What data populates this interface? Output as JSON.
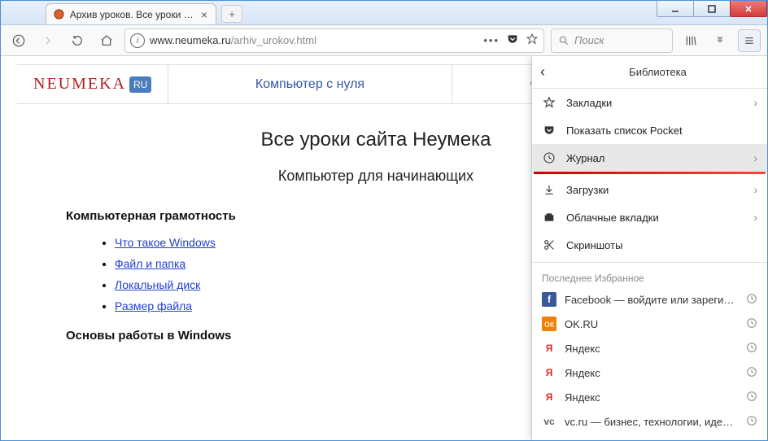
{
  "window": {
    "tab_title": "Архив уроков. Все уроки сайт",
    "url_host": "www.neumeka.ru",
    "url_path": "/arhiv_urokov.html",
    "search_placeholder": "Поиск"
  },
  "site": {
    "logo": "NEUMEKA",
    "logo_badge": "RU",
    "nav": [
      "Компьютер с нуля",
      "Обучение Интернету"
    ]
  },
  "page": {
    "h1": "Все уроки сайта Неумека",
    "h2": "Компьютер для начинающих",
    "section1_title": "Компьютерная грамотность",
    "links": [
      "Что такое Windows",
      "Файл и папка",
      "Локальный диск",
      "Размер файла"
    ],
    "section2_title": "Основы работы в Windows"
  },
  "panel": {
    "title": "Библиотека",
    "items": [
      {
        "icon": "star",
        "label": "Закладки",
        "chevron": true
      },
      {
        "icon": "pocket",
        "label": "Показать список Pocket",
        "chevron": false
      },
      {
        "icon": "clock",
        "label": "Журнал",
        "chevron": true,
        "highlight": true
      },
      {
        "icon": "download",
        "label": "Загрузки",
        "chevron": true
      },
      {
        "icon": "cloud-tabs",
        "label": "Облачные вкладки",
        "chevron": true
      },
      {
        "icon": "scissors",
        "label": "Скриншоты",
        "chevron": false
      }
    ],
    "recent_title": "Последнее Избранное",
    "recent": [
      {
        "favicon": "fb",
        "label": "Facebook — войдите или зарегистри..."
      },
      {
        "favicon": "ok",
        "label": "OK.RU"
      },
      {
        "favicon": "ya",
        "label": "Яндекс"
      },
      {
        "favicon": "ya",
        "label": "Яндекс"
      },
      {
        "favicon": "ya",
        "label": "Яндекс"
      },
      {
        "favicon": "vc",
        "label": "vc.ru — бизнес, технологии, идеи, мо..."
      }
    ]
  }
}
